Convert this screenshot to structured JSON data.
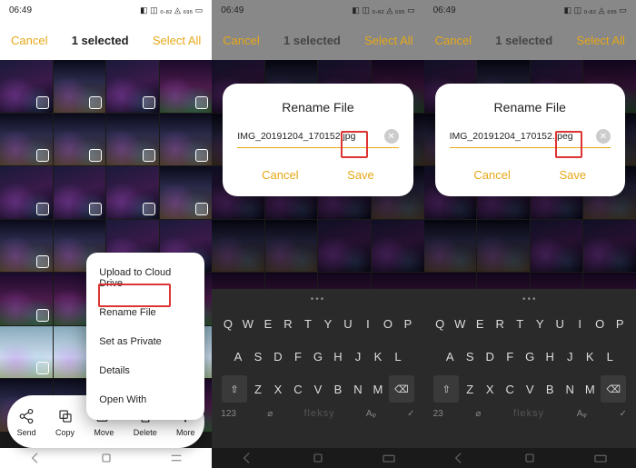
{
  "status": {
    "time": "06:49",
    "icons": "⬤ ♡ ◐ ▦",
    "right": "◧ ◫ ₀.₈₂ ◬ ₆₉₅ ▭"
  },
  "screen1": {
    "topbar": {
      "cancel": "Cancel",
      "title": "1 selected",
      "selectAll": "Select All"
    },
    "menu": {
      "upload": "Upload to Cloud Drive",
      "rename": "Rename File",
      "private": "Set as Private",
      "details": "Details",
      "open": "Open With"
    },
    "bottombar": {
      "send": "Send",
      "copy": "Copy",
      "move": "Move",
      "delete": "Delete",
      "more": "More"
    }
  },
  "screen2": {
    "dialog": {
      "title": "Rename File",
      "filename": "IMG_20191204_170152.jpg",
      "cancel": "Cancel",
      "save": "Save"
    }
  },
  "screen3": {
    "dialog": {
      "title": "Rename File",
      "filename": "IMG_20191204_170152.jpeg",
      "cancel": "Cancel",
      "save": "Save"
    }
  },
  "keyboard": {
    "row1": [
      "Q",
      "W",
      "E",
      "R",
      "T",
      "Y",
      "U",
      "I",
      "O",
      "P"
    ],
    "row2": [
      "A",
      "S",
      "D",
      "F",
      "G",
      "H",
      "J",
      "K",
      "L"
    ],
    "row3_shift": "⇧",
    "row3": [
      "Z",
      "X",
      "C",
      "V",
      "B",
      "N",
      "M"
    ],
    "row3_del": "⌫",
    "numkey": "123",
    "brand": "fleksy",
    "check": "✓",
    "numkey2": "23"
  }
}
